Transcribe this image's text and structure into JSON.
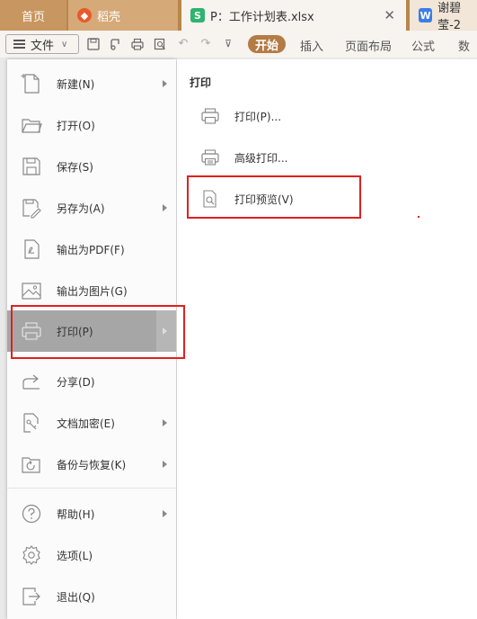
{
  "tabs": {
    "home": "首页",
    "doc": "稻壳",
    "xlsx": "P：工作计划表.xlsx",
    "word": "谢碧莹-2"
  },
  "toolbar": {
    "file_label": "文件",
    "ribbon_tabs": [
      "开始",
      "插入",
      "页面布局",
      "公式",
      "数据"
    ]
  },
  "file_menu": {
    "items": [
      {
        "label": "新建(N)",
        "icon": "new-file-icon",
        "has_arrow": true
      },
      {
        "label": "打开(O)",
        "icon": "folder-icon",
        "has_arrow": false
      },
      {
        "label": "保存(S)",
        "icon": "save-icon",
        "has_arrow": false
      },
      {
        "label": "另存为(A)",
        "icon": "save-as-icon",
        "has_arrow": true
      },
      {
        "label": "输出为PDF(F)",
        "icon": "pdf-icon",
        "has_arrow": false
      },
      {
        "label": "输出为图片(G)",
        "icon": "image-icon",
        "has_arrow": false
      },
      {
        "label": "打印(P)",
        "icon": "printer-icon",
        "has_arrow": true
      },
      {
        "label": "分享(D)",
        "icon": "share-icon",
        "has_arrow": false
      },
      {
        "label": "文档加密(E)",
        "icon": "encrypt-icon",
        "has_arrow": true
      },
      {
        "label": "备份与恢复(K)",
        "icon": "backup-icon",
        "has_arrow": true
      },
      {
        "label": "帮助(H)",
        "icon": "help-icon",
        "has_arrow": true
      },
      {
        "label": "选项(L)",
        "icon": "gear-icon",
        "has_arrow": false
      },
      {
        "label": "退出(Q)",
        "icon": "exit-icon",
        "has_arrow": false
      }
    ]
  },
  "print_submenu": {
    "title": "打印",
    "items": [
      {
        "label": "打印(P)...",
        "icon": "printer-icon"
      },
      {
        "label": "高级打印...",
        "icon": "advanced-print-icon"
      },
      {
        "label": "打印预览(V)",
        "icon": "print-preview-icon"
      }
    ]
  },
  "colors": {
    "tab_bar": "#b8864a",
    "accent_button": "#b37b45",
    "highlight_box": "#e02020",
    "active_menu": "#a6a6a6"
  }
}
